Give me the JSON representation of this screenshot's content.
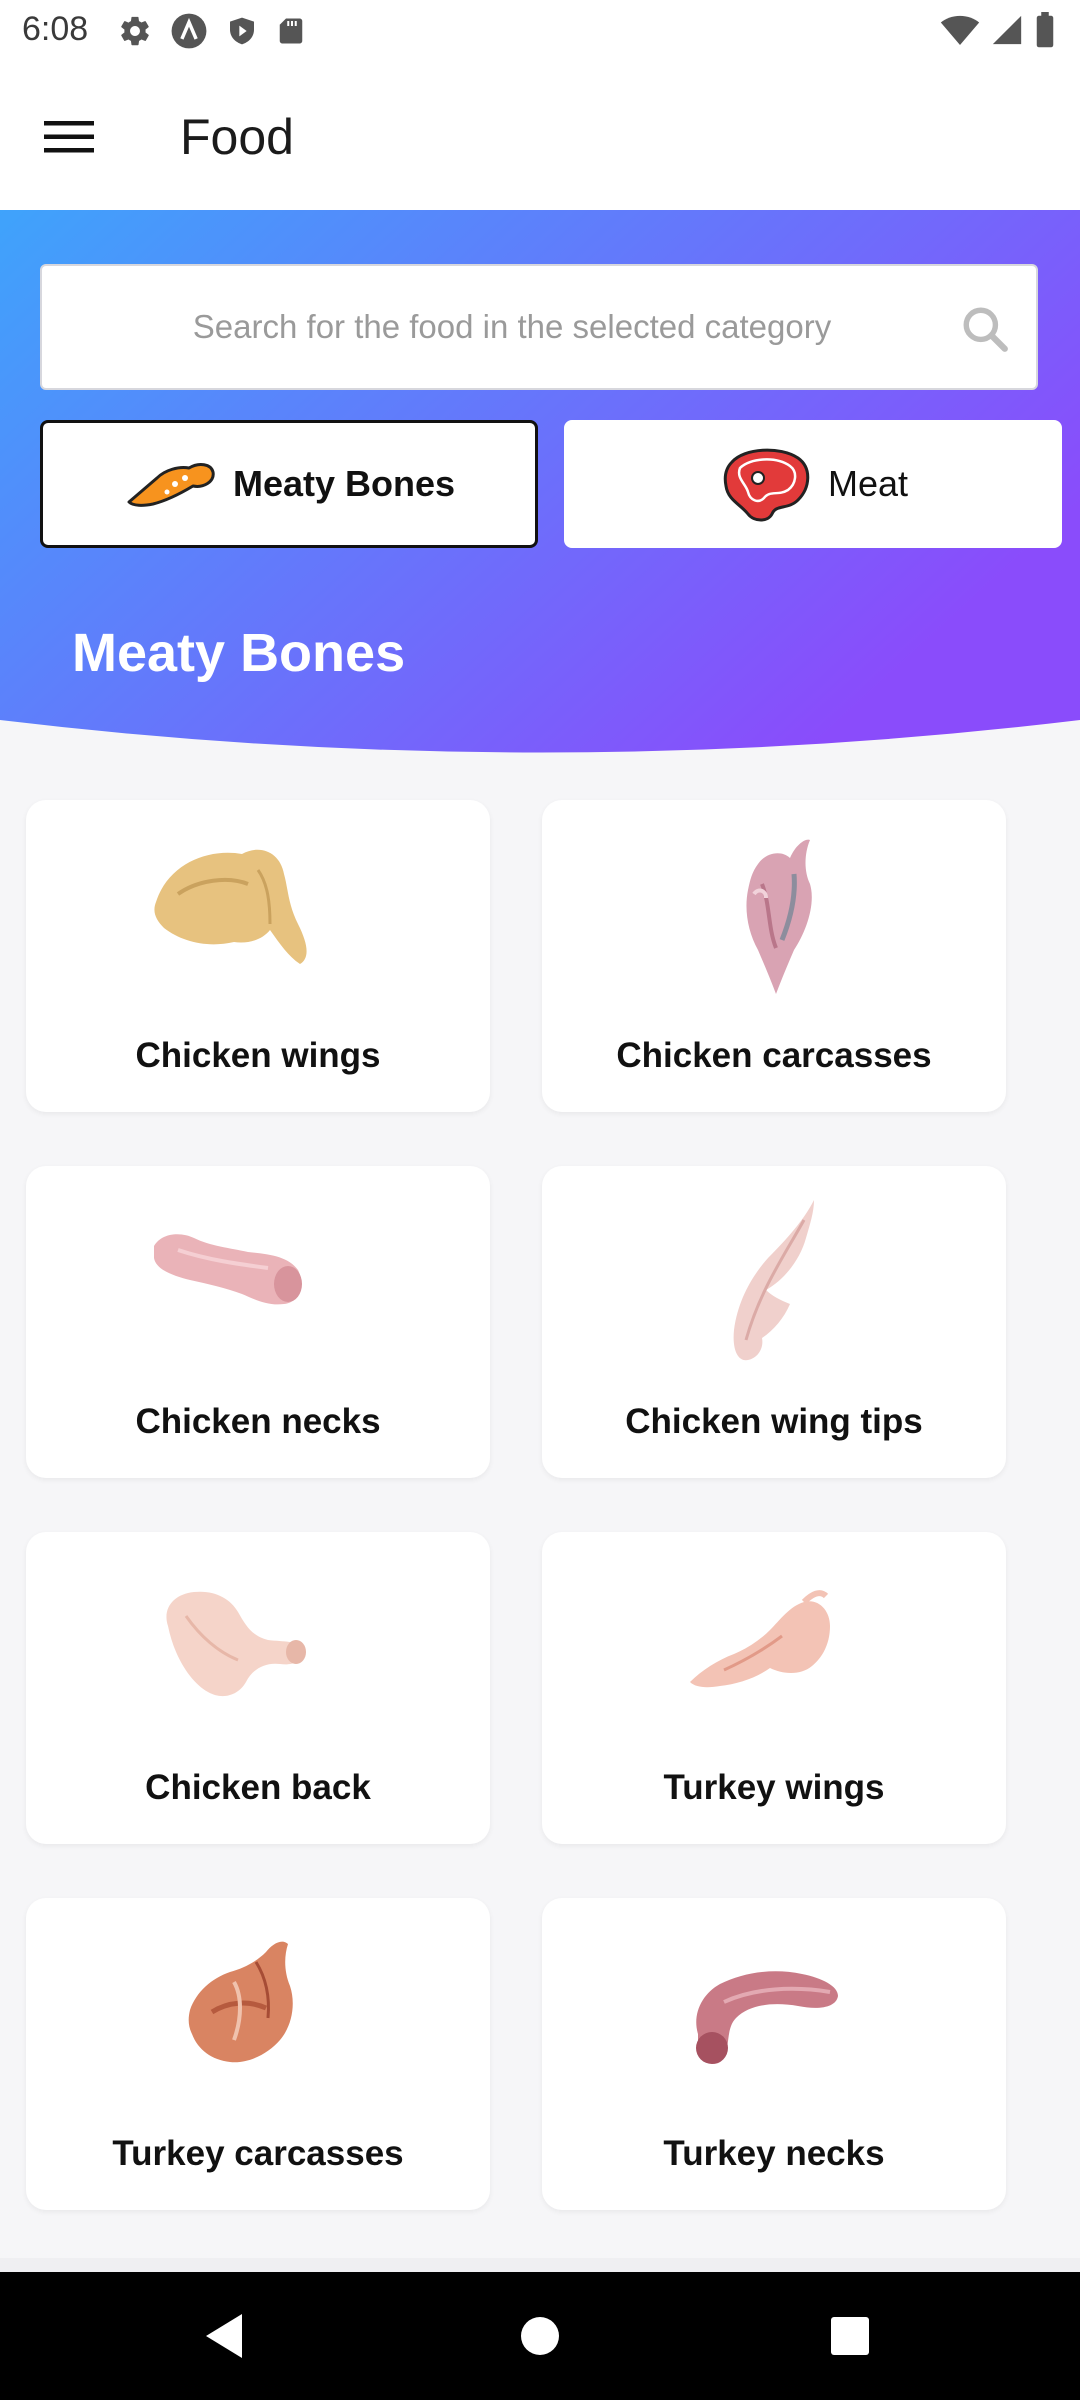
{
  "status_bar": {
    "time": "6:08",
    "left_icons": [
      "gear-icon",
      "a-logo-icon",
      "shield-icon",
      "sd-card-icon"
    ],
    "right_icons": [
      "wifi-icon",
      "signal-icon",
      "battery-icon"
    ]
  },
  "app_bar": {
    "title": "Food",
    "menu_icon": "hamburger-menu-icon"
  },
  "search": {
    "placeholder": "Search for the food in the selected category",
    "icon": "search-icon"
  },
  "categories": [
    {
      "label": "Meaty Bones",
      "icon": "chicken-wing-icon",
      "selected": true
    },
    {
      "label": "Meat",
      "icon": "steak-icon",
      "selected": false
    }
  ],
  "section_title": "Meaty Bones",
  "header_gradient": {
    "from": "#3fa3fb",
    "to": "#8a4cfb"
  },
  "items": [
    {
      "name": "Chicken wings",
      "image": "chicken-wings-image"
    },
    {
      "name": "Chicken carcasses",
      "image": "chicken-carcasses-image"
    },
    {
      "name": "Chicken necks",
      "image": "chicken-necks-image"
    },
    {
      "name": "Chicken wing tips",
      "image": "chicken-wing-tips-image"
    },
    {
      "name": "Chicken back",
      "image": "chicken-back-image"
    },
    {
      "name": "Turkey wings",
      "image": "turkey-wings-image"
    },
    {
      "name": "Turkey carcasses",
      "image": "turkey-carcasses-image"
    },
    {
      "name": "Turkey necks",
      "image": "turkey-necks-image"
    }
  ],
  "nav_bar": {
    "buttons": [
      "back-icon",
      "home-icon",
      "recents-icon"
    ]
  }
}
